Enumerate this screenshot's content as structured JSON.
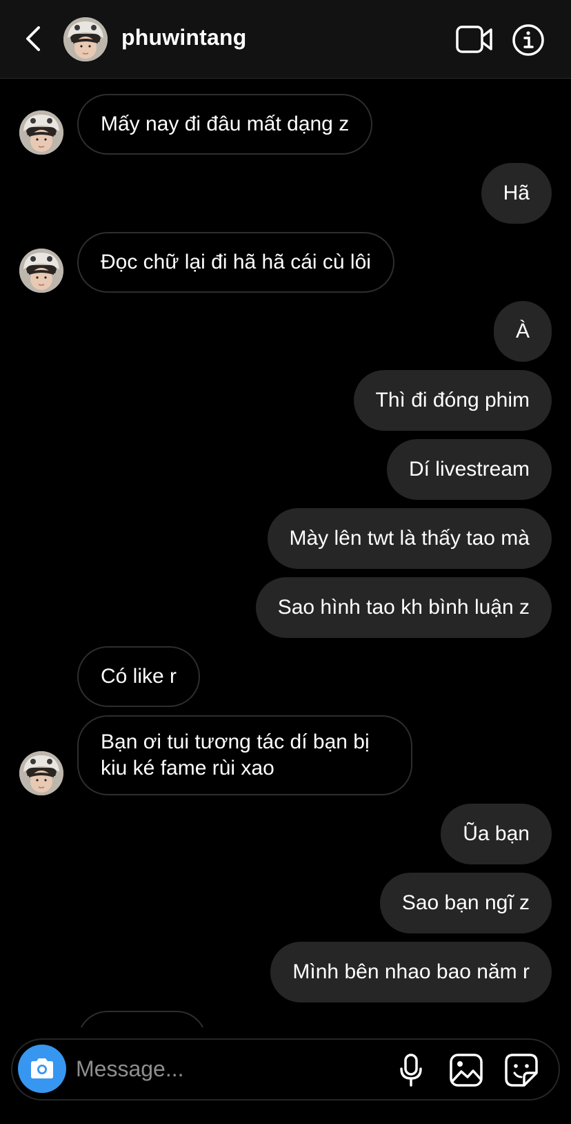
{
  "header": {
    "username": "phuwintang"
  },
  "messages": [
    {
      "side": "in",
      "text": "Mấy nay đi đâu mất dạng z"
    },
    {
      "side": "out",
      "text": "Hã"
    },
    {
      "side": "in",
      "text": "Đọc chữ lại đi hã hã cái cù lôi"
    },
    {
      "side": "out",
      "text": "À"
    },
    {
      "side": "out",
      "text": "Thì đi đóng phim"
    },
    {
      "side": "out",
      "text": "Dí livestream"
    },
    {
      "side": "out",
      "text": "Mày lên twt là thấy tao mà"
    },
    {
      "side": "out",
      "text": "Sao hình tao kh bình luận z"
    },
    {
      "side": "in",
      "text": "Có like r"
    },
    {
      "side": "in",
      "text": "Bạn ơi tui tương tác dí bạn bị kiu ké fame rùi xao"
    },
    {
      "side": "out",
      "text": "Ũa bạn"
    },
    {
      "side": "out",
      "text": "Sao bạn ngĩ z"
    },
    {
      "side": "out",
      "text": "Mình bên nhao bao năm r"
    }
  ],
  "composer": {
    "placeholder": "Message..."
  },
  "icons": {
    "back": "chevron-left-icon",
    "video": "video-camera-icon",
    "info": "info-icon",
    "camera": "camera-icon",
    "mic": "microphone-icon",
    "gallery": "image-icon",
    "sticker": "sticker-icon"
  },
  "colors": {
    "background": "#000000",
    "header": "#121212",
    "outgoing_bubble": "#262626",
    "incoming_border": "#2e2e2e",
    "camera_button": "#3797f0",
    "placeholder": "#8e8e8e"
  }
}
